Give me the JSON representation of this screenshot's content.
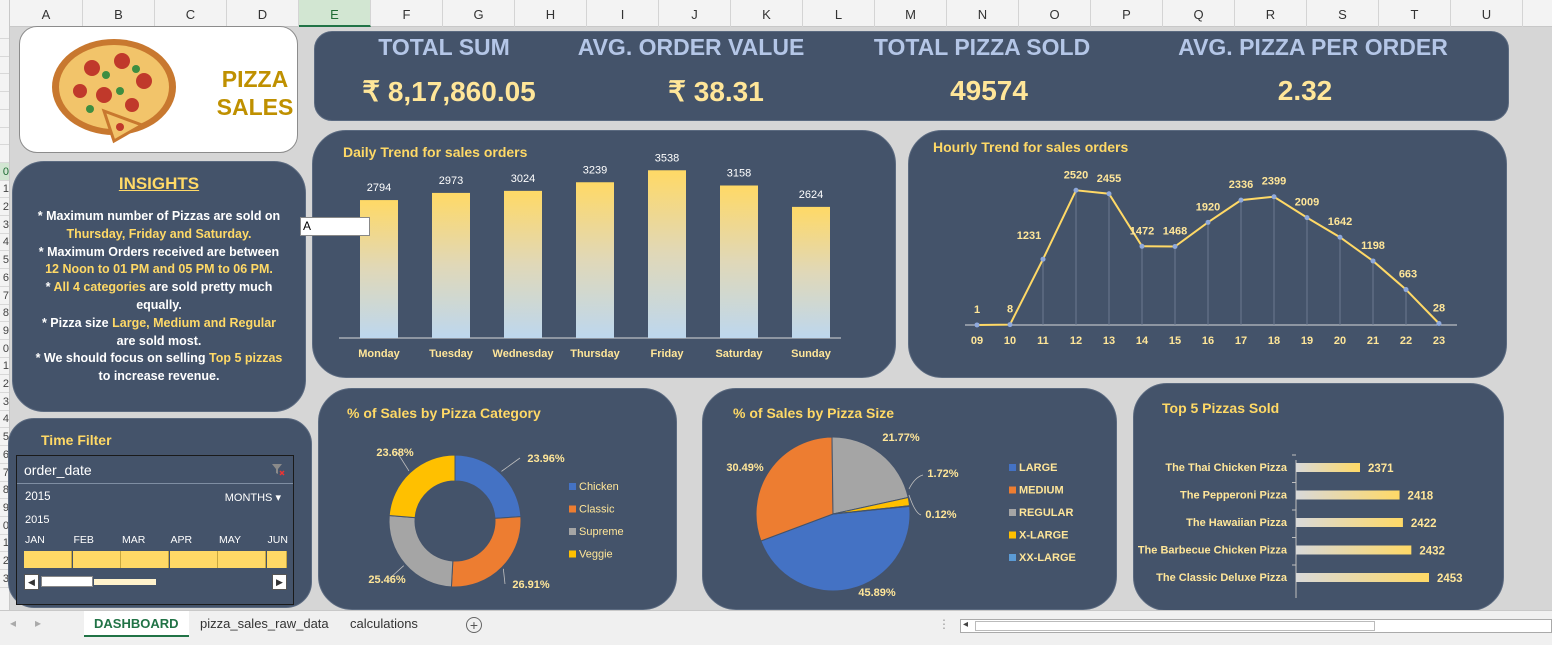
{
  "sheet": {
    "columns": [
      "A",
      "B",
      "C",
      "D",
      "E",
      "F",
      "G",
      "H",
      "I",
      "J",
      "K",
      "L",
      "M",
      "N",
      "O",
      "P",
      "Q",
      "R",
      "S",
      "T",
      "U"
    ],
    "rows": [
      "",
      "",
      "",
      "",
      "",
      "",
      "",
      "",
      "0",
      "1",
      "2",
      "3",
      "4",
      "5",
      "6",
      "7",
      "8",
      "9",
      "0",
      "1",
      "2",
      "3",
      "4",
      "5",
      "6",
      "7",
      "8",
      "9",
      "0",
      "1",
      "2",
      "3"
    ],
    "selected_column": "E",
    "selected_row": "0",
    "cell_value": "A"
  },
  "logo": {
    "line1": "PIZZA",
    "line2": "SALES"
  },
  "kpis": [
    {
      "label": "TOTAL SUM",
      "value": "₹ 8,17,860.05"
    },
    {
      "label": "AVG. ORDER VALUE",
      "value": "₹ 38.31"
    },
    {
      "label": "TOTAL PIZZA SOLD",
      "value": "49574"
    },
    {
      "label": "AVG. PIZZA PER ORDER",
      "value": "2.32"
    }
  ],
  "insights": {
    "title": "INSIGHTS",
    "lines": [
      [
        {
          "t": "* Maximum number of Pizzas are sold on",
          "h": false
        }
      ],
      [
        {
          "t": "Thursday, Friday and Saturday.",
          "h": true
        }
      ],
      [
        {
          "t": "* Maximum Orders received are between",
          "h": false
        }
      ],
      [
        {
          "t": "12 Noon to 01 PM and 05 PM to 06 PM.",
          "h": true
        }
      ],
      [
        {
          "t": "* ",
          "h": false
        },
        {
          "t": "All 4 categories",
          "h": true
        },
        {
          "t": " are sold pretty much",
          "h": false
        }
      ],
      [
        {
          "t": "equally.",
          "h": false
        }
      ],
      [
        {
          "t": "* Pizza size ",
          "h": false
        },
        {
          "t": "Large, Medium and Regular",
          "h": true
        }
      ],
      [
        {
          "t": "are sold most.",
          "h": false
        }
      ],
      [
        {
          "t": "* We should focus on selling ",
          "h": false
        },
        {
          "t": "Top 5 pizzas",
          "h": true
        }
      ],
      [
        {
          "t": "to increase revenue.",
          "h": false
        }
      ]
    ]
  },
  "time_filter": {
    "title": "Time Filter",
    "field": "order_date",
    "year": "2015",
    "level": "MONTHS",
    "year_row": "2015",
    "months": [
      "JAN",
      "FEB",
      "MAR",
      "APR",
      "MAY",
      "JUN"
    ]
  },
  "colors": {
    "card_bg": "#44536a",
    "accent": "#ffd966",
    "chicken": "#4472c4",
    "classic": "#ed7d31",
    "supreme": "#a5a5a5",
    "veggie": "#ffc000"
  },
  "tabs": [
    "DASHBOARD",
    "pizza_sales_raw_data",
    "calculations"
  ],
  "chart_data": [
    {
      "id": "daily",
      "type": "bar",
      "title": "Daily Trend for sales orders",
      "categories": [
        "Monday",
        "Tuesday",
        "Wednesday",
        "Thursday",
        "Friday",
        "Saturday",
        "Sunday"
      ],
      "values": [
        2794,
        2973,
        3024,
        3239,
        3538,
        3158,
        2624
      ],
      "ylim": [
        0,
        3800
      ]
    },
    {
      "id": "hourly",
      "type": "line",
      "title": "Hourly Trend for sales orders",
      "categories": [
        "09",
        "10",
        "11",
        "12",
        "13",
        "14",
        "15",
        "16",
        "17",
        "18",
        "19",
        "20",
        "21",
        "22",
        "23"
      ],
      "values": [
        1,
        8,
        1231,
        2520,
        2455,
        1472,
        1468,
        1920,
        2336,
        2399,
        2009,
        1642,
        1198,
        663,
        28
      ],
      "ylim": [
        0,
        2600
      ]
    },
    {
      "id": "category",
      "type": "pie",
      "title": "% of Sales by Pizza Category",
      "labels": [
        "Chicken",
        "Classic",
        "Supreme",
        "Veggie"
      ],
      "values": [
        23.96,
        26.91,
        25.46,
        23.68
      ],
      "value_labels": [
        "23.96%",
        "26.91%",
        "25.46%",
        "23.68%"
      ],
      "legend": "right"
    },
    {
      "id": "size",
      "type": "pie",
      "title": "% of Sales by Pizza Size",
      "labels": [
        "LARGE",
        "MEDIUM",
        "REGULAR",
        "X-LARGE",
        "XX-LARGE"
      ],
      "values": [
        45.89,
        30.49,
        21.77,
        1.72,
        0.12
      ],
      "value_labels": [
        "45.89%",
        "30.49%",
        "21.77%",
        "1.72%",
        "0.12%"
      ],
      "legend": "right"
    },
    {
      "id": "top5",
      "type": "bar",
      "title": "Top 5 Pizzas Sold",
      "categories": [
        "The Thai Chicken Pizza",
        "The Pepperoni Pizza",
        "The Hawaiian Pizza",
        "The Barbecue Chicken Pizza",
        "The Classic Deluxe Pizza"
      ],
      "values": [
        2371,
        2418,
        2422,
        2432,
        2453
      ]
    }
  ]
}
